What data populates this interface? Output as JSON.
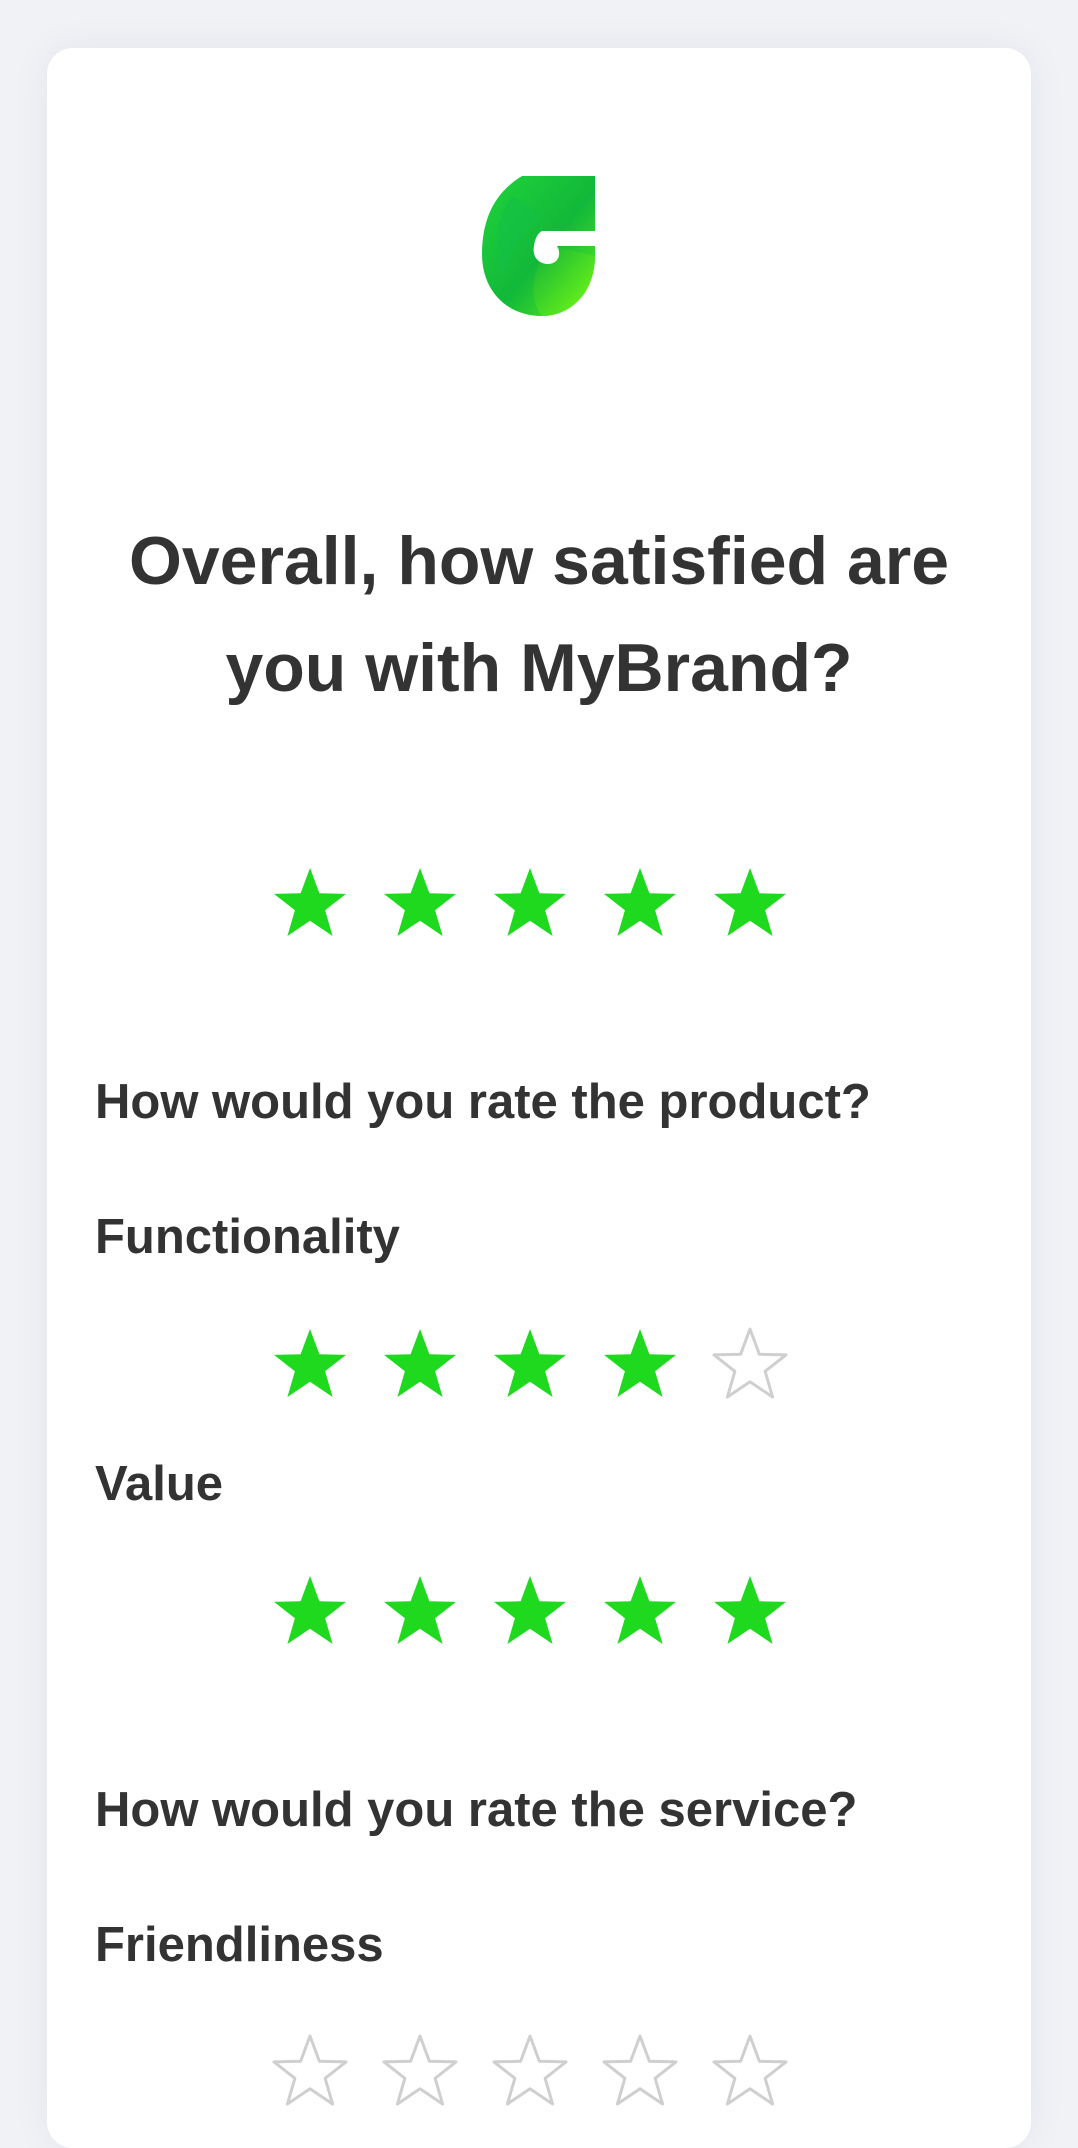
{
  "brand": {
    "logo_icon": "brand-leaf-logo",
    "accent_color": "#1ed91e",
    "empty_star_color": "#cfcfcf"
  },
  "survey": {
    "main_question": "Overall, how satisfied are you with MyBrand?",
    "overall_rating": 5,
    "max_rating": 5,
    "product_heading": "How would you rate the product?",
    "functionality_label": "Functionality",
    "functionality_rating": 4,
    "value_label": "Value",
    "value_rating": 5,
    "service_heading": "How would you rate the service?",
    "friendliness_label": "Friendliness",
    "friendliness_rating": 0
  }
}
